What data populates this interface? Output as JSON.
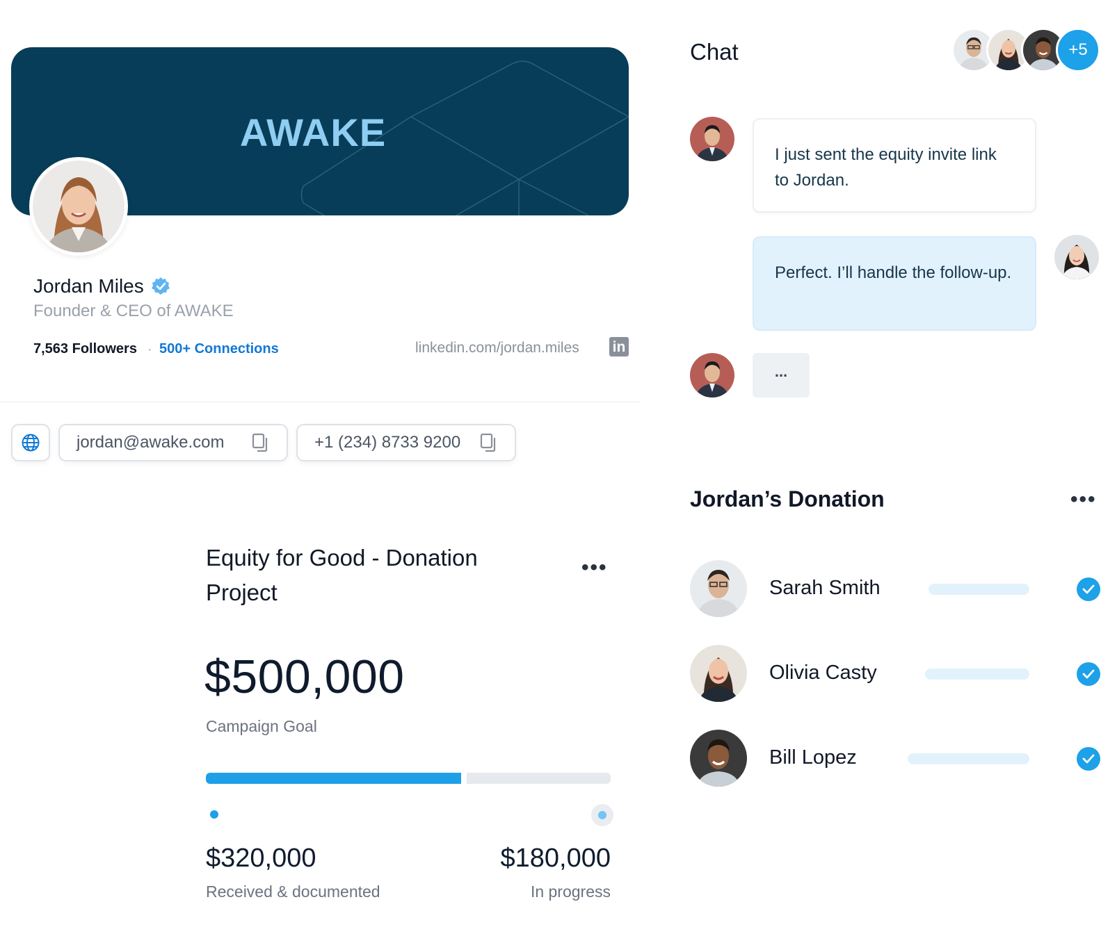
{
  "profile": {
    "banner_logo": "AWAKE",
    "name": "Jordan Miles",
    "title": "Founder & CEO of AWAKE",
    "followers": "7,563 Followers",
    "separator": "·",
    "connections": "500+ Connections",
    "linkedin_url": "linkedin.com/jordan.miles",
    "linkedin_icon": "in",
    "email": "jordan@awake.com",
    "phone": "+1 (234) 8733 9200"
  },
  "campaign": {
    "title": "Equity for Good - Donation Project",
    "more": "•••",
    "goal_amount": "$500,000",
    "goal_label": "Campaign Goal",
    "progress_fraction": 0.64,
    "received_amount": "$320,000",
    "received_label": "Received & documented",
    "in_progress_amount": "$180,000",
    "in_progress_label": "In progress"
  },
  "chat": {
    "title": "Chat",
    "extra_members": "+5",
    "messages": [
      {
        "text": "I just sent the equity invite link to Jordan."
      },
      {
        "text": "Perfect. I’ll handle the follow-up."
      }
    ],
    "typing": "..."
  },
  "donation": {
    "title": "Jordan’s Donation",
    "more": "•••",
    "donors": [
      {
        "name": "Sarah Smith",
        "bar_fraction": 0.58,
        "status": "check-icon"
      },
      {
        "name": "Olivia Casty",
        "bar_fraction": 0.6,
        "status": "check-icon"
      },
      {
        "name": "Bill Lopez",
        "bar_fraction": 0.7,
        "status": "check-icon"
      }
    ]
  },
  "colors": {
    "banner": "#073d58",
    "accent": "#1da1e8",
    "link": "#1178d4",
    "bubble_out": "#e2f2fd"
  }
}
